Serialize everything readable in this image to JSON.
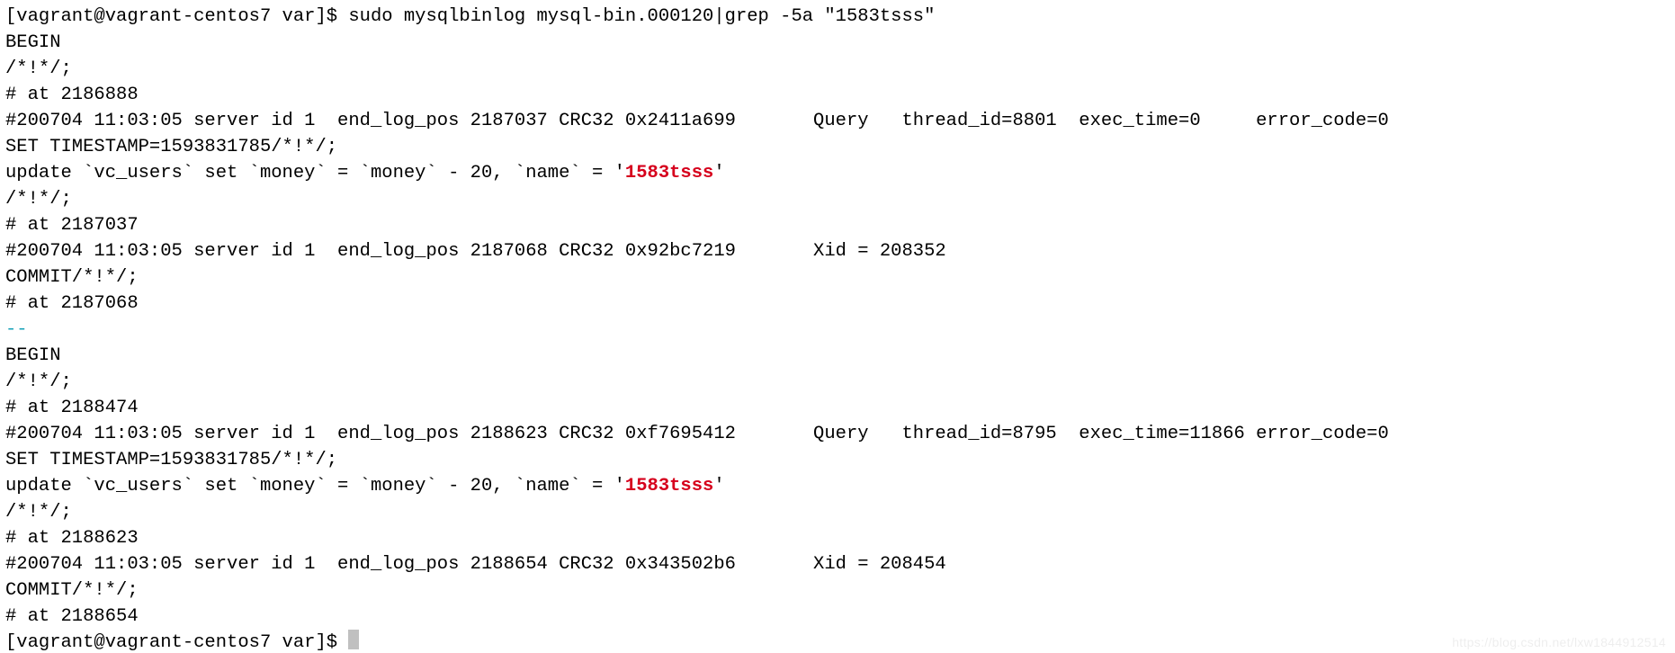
{
  "prompt1": "[vagrant@vagrant-centos7 var]$ ",
  "cmd1": "sudo mysqlbinlog mysql-bin.000120|grep -5a \"1583tsss\"",
  "block1": {
    "l1": "BEGIN",
    "l2": "/*!*/;",
    "l3": "# at 2186888",
    "l4": "#200704 11:03:05 server id 1  end_log_pos 2187037 CRC32 0x2411a699       Query   thread_id=8801  exec_time=0     error_code=0",
    "l5": "SET TIMESTAMP=1593831785/*!*/;",
    "l6a": "update `vc_users` set `money` = `money` - 20, `name` = '",
    "l6b": "1583tsss",
    "l6c": "'",
    "l7": "/*!*/;",
    "l8": "# at 2187037",
    "l9": "#200704 11:03:05 server id 1  end_log_pos 2187068 CRC32 0x92bc7219       Xid = 208352",
    "l10": "COMMIT/*!*/;",
    "l11": "# at 2187068"
  },
  "separator": "--",
  "block2": {
    "l1": "BEGIN",
    "l2": "/*!*/;",
    "l3": "# at 2188474",
    "l4": "#200704 11:03:05 server id 1  end_log_pos 2188623 CRC32 0xf7695412       Query   thread_id=8795  exec_time=11866 error_code=0",
    "l5": "SET TIMESTAMP=1593831785/*!*/;",
    "l6a": "update `vc_users` set `money` = `money` - 20, `name` = '",
    "l6b": "1583tsss",
    "l6c": "'",
    "l7": "/*!*/;",
    "l8": "# at 2188623",
    "l9": "#200704 11:03:05 server id 1  end_log_pos 2188654 CRC32 0x343502b6       Xid = 208454",
    "l10": "COMMIT/*!*/;",
    "l11": "# at 2188654"
  },
  "prompt2": "[vagrant@vagrant-centos7 var]$ ",
  "watermark": "https://blog.csdn.net/lxw1844912514"
}
